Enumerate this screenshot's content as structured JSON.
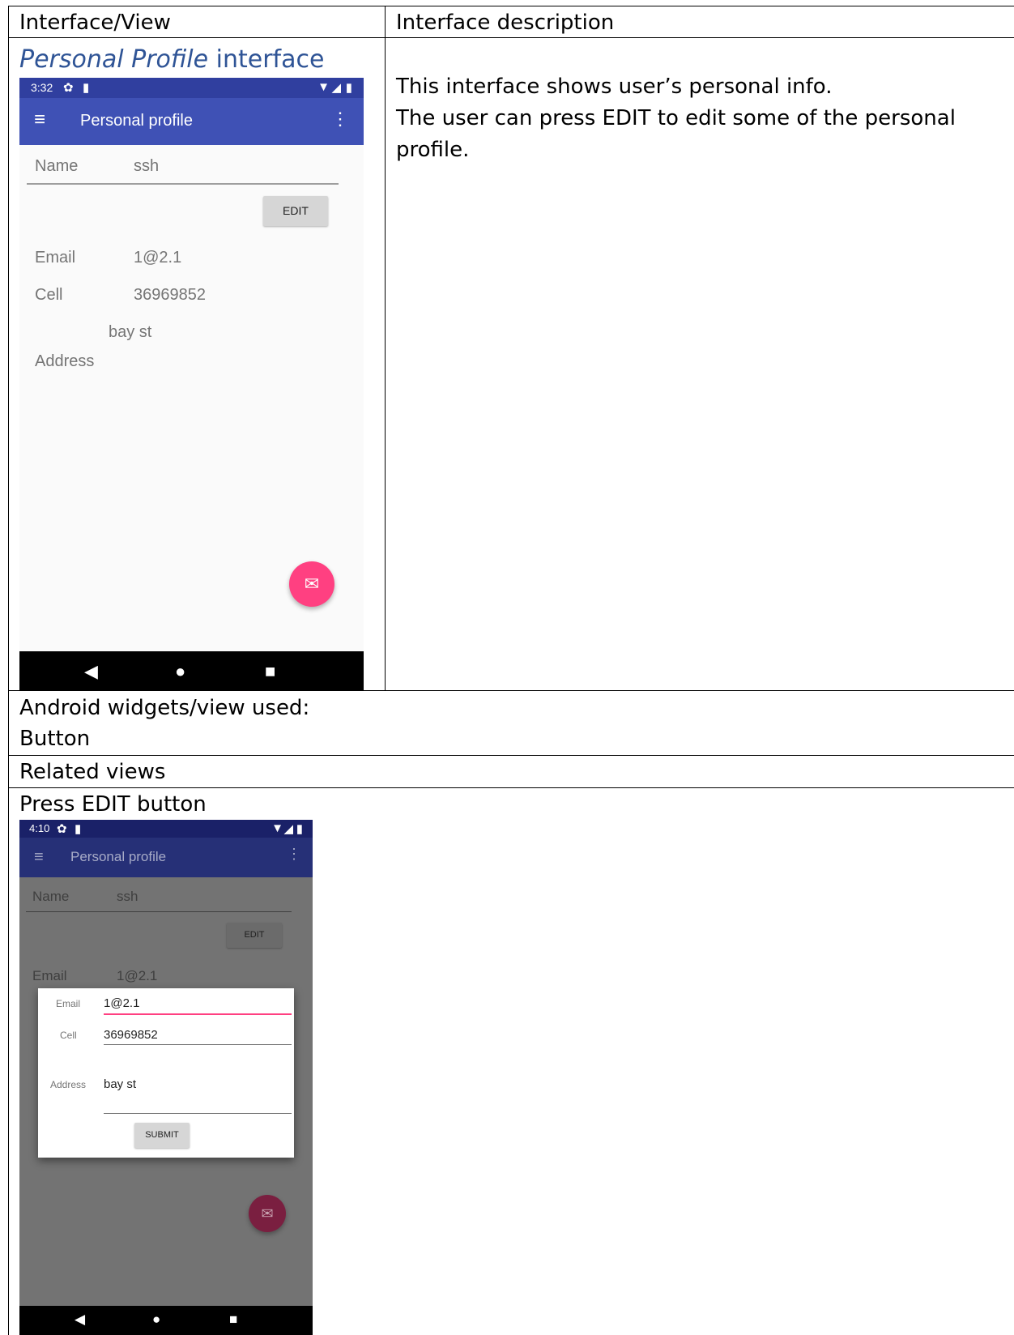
{
  "table": {
    "header_left": "Interface/View",
    "header_right": "Interface description",
    "row1_title_italic": "Personal Profile",
    "row1_title_rest": " interface",
    "description_lines": [
      "This interface shows user’s personal info.",
      "The user can press EDIT to edit some of the personal profile."
    ],
    "widgets_label": "Android widgets/view used:",
    "widgets_value": "Button",
    "related_label": "Related views",
    "related_caption": "Press EDIT button"
  },
  "phone1": {
    "time": "3:32",
    "app_title": "Personal profile",
    "name_label": "Name",
    "name_value": "ssh",
    "edit_label": "EDIT",
    "email_label": "Email",
    "email_value": "1@2.1",
    "cell_label": "Cell",
    "cell_value": "36969852",
    "address_value": "bay st",
    "address_label": "Address"
  },
  "phone2": {
    "time": "4:10",
    "app_title": "Personal profile",
    "name_label": "Name",
    "name_value": "ssh",
    "edit_label": "EDIT",
    "email_bg_label": "Email",
    "email_bg_value": "1@2.1",
    "dialog": {
      "email_label": "Email",
      "email_value": "1@2.1",
      "cell_label": "Cell",
      "cell_value": "36969852",
      "address_label": "Address",
      "address_value": "bay st",
      "submit_label": "SUBMIT"
    }
  },
  "colors": {
    "primary": "#3f51b5",
    "primary_dark": "#303f9f",
    "accent": "#ff4081",
    "heading_blue": "#2f5496"
  },
  "icons": [
    "gear-icon",
    "sd-card-icon",
    "wifi-icon",
    "signal-icon",
    "battery-icon",
    "menu-icon",
    "more-vert-icon",
    "mail-icon",
    "back-icon",
    "home-icon",
    "recents-icon"
  ]
}
